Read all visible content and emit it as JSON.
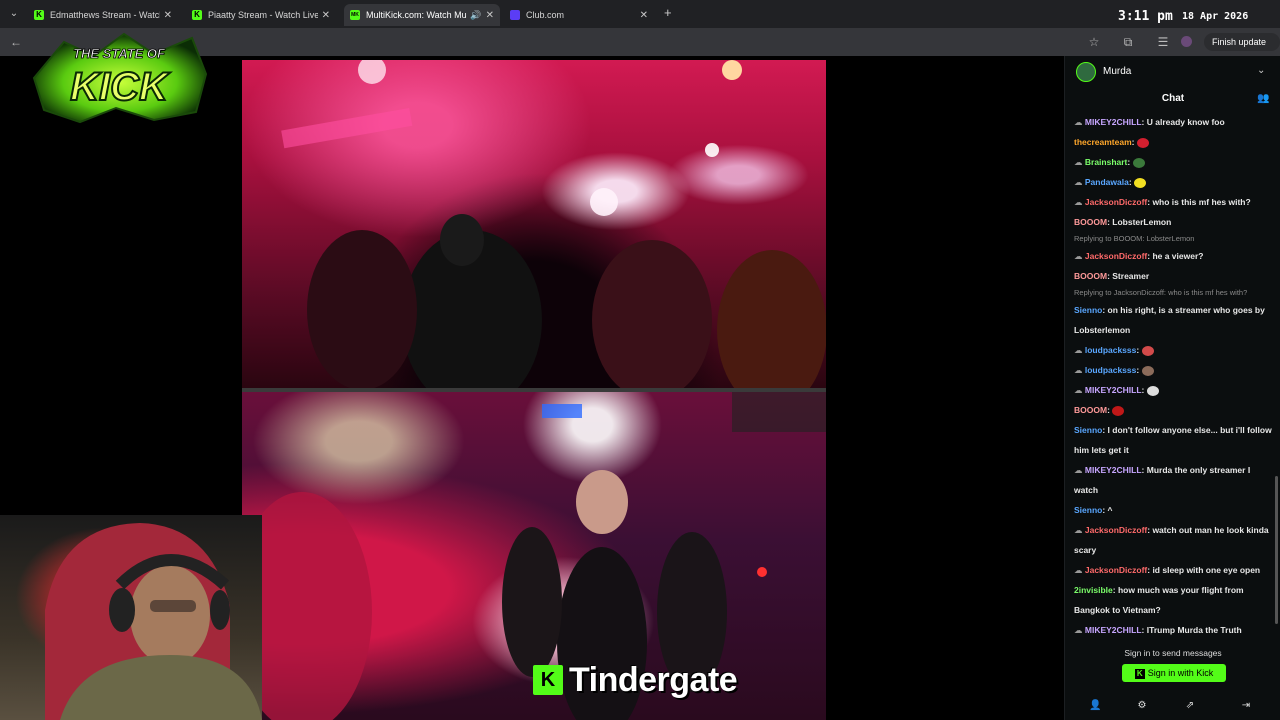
{
  "browser": {
    "tabs": [
      {
        "title": "Edmatthews Stream - Watch Li",
        "fav_color": "#53fc18",
        "fav": "K"
      },
      {
        "title": "Piaatty Stream - Watch Live on",
        "fav_color": "#53fc18",
        "fav": "K"
      },
      {
        "title": "MultiKick.com: Watch Multi",
        "fav_color": "#53fc18",
        "fav": "MK"
      },
      {
        "title": "Club.com",
        "fav_color": "#5b3df5",
        "fav": ""
      }
    ],
    "clock": "3:11 pm",
    "date": "18 Apr 2026",
    "finish_update": "Finish update"
  },
  "overlay": {
    "logo_text": "THE STATE OF KICK",
    "caption_k": "K",
    "caption": "Tindergate"
  },
  "chat": {
    "channel": "Murda",
    "title": "Chat",
    "signin_prompt": "Sign in to send messages",
    "signin_button": "Sign in with Kick",
    "messages": [
      {
        "user": "MIKEY2CHILL",
        "color": "#c7a6ff",
        "badge": true,
        "text": "U already know foo"
      },
      {
        "user": "thecreamteam",
        "color": "#ffa72b",
        "badge": false,
        "text": "",
        "emote": "#d21f2f"
      },
      {
        "user": "Brainshart",
        "color": "#7cff6b",
        "badge": true,
        "text": "",
        "emote": "#3b7a3b"
      },
      {
        "user": "Pandawala",
        "color": "#5aa7ff",
        "badge": true,
        "text": "",
        "emote": "#f2df22"
      },
      {
        "user": "JacksonDiczoff",
        "color": "#ff6a6a",
        "badge": true,
        "text": "who is this mf hes with?"
      },
      {
        "user": "BOOOM",
        "color": "#ff9a9a",
        "badge": false,
        "text": "LobsterLemon"
      },
      {
        "reply": true,
        "text": "Replying to BOOOM: LobsterLemon"
      },
      {
        "user": "JacksonDiczoff",
        "color": "#ff6a6a",
        "badge": true,
        "text": "he a viewer?"
      },
      {
        "user": "BOOOM",
        "color": "#ff9a9a",
        "badge": false,
        "text": "Streamer"
      },
      {
        "reply": true,
        "text": "Replying to JacksonDiczoff: who is this mf hes with?"
      },
      {
        "user": "Sienno",
        "color": "#5aa7ff",
        "badge": false,
        "text": "on his right, is a streamer who goes by Lobsterlemon",
        "wrap": true
      },
      {
        "user": "loudpacksss",
        "color": "#5aa7ff",
        "badge": true,
        "text": "",
        "emote": "#d24a4a"
      },
      {
        "user": "loudpacksss",
        "color": "#5aa7ff",
        "badge": true,
        "text": "",
        "emote": "#8b6b5a"
      },
      {
        "user": "MIKEY2CHILL",
        "color": "#c7a6ff",
        "badge": true,
        "text": "",
        "emote": "#dddddd"
      },
      {
        "user": "BOOOM",
        "color": "#ff9a9a",
        "badge": false,
        "text": "",
        "emote": "#c01818"
      },
      {
        "user": "Sienno",
        "color": "#5aa7ff",
        "badge": false,
        "text": "I don't follow anyone else... but i'll follow him lets get it",
        "wrap": true
      },
      {
        "user": "MIKEY2CHILL",
        "color": "#c7a6ff",
        "badge": true,
        "text": "Murda the only streamer I watch",
        "wrap": true
      },
      {
        "user": "Sienno",
        "color": "#5aa7ff",
        "badge": false,
        "text": "^"
      },
      {
        "user": "JacksonDiczoff",
        "color": "#ff6a6a",
        "badge": true,
        "text": "watch out man he look kinda scary",
        "wrap": true
      },
      {
        "user": "JacksonDiczoff",
        "color": "#ff6a6a",
        "badge": true,
        "text": "id sleep with one eye open"
      },
      {
        "user": "2invisible",
        "color": "#7cff6b",
        "badge": false,
        "text": "how much was your flight from Bangkok to Vietnam?",
        "wrap": true
      },
      {
        "user": "MIKEY2CHILL",
        "color": "#c7a6ff",
        "badge": true,
        "text": "ITrump Murda the Truth"
      }
    ]
  }
}
